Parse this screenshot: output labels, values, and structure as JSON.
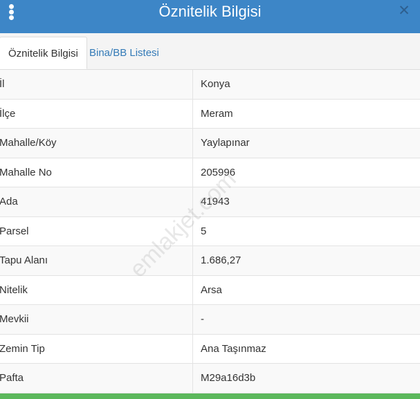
{
  "header": {
    "title": "Öznitelik Bilgisi",
    "close_symbol": "✕",
    "menu_icon": "kebab-vertical-icon",
    "color": "#3d86c7"
  },
  "tabs": [
    {
      "label": "Öznitelik Bilgisi",
      "active": true
    },
    {
      "label": "Bina/BB Listesi",
      "active": false
    }
  ],
  "rows": [
    {
      "label": "İl",
      "value": "Konya"
    },
    {
      "label": "İlçe",
      "value": "Meram"
    },
    {
      "label": "Mahalle/Köy",
      "value": "Yaylapınar"
    },
    {
      "label": "Mahalle No",
      "value": "205996"
    },
    {
      "label": "Ada",
      "value": "41943"
    },
    {
      "label": "Parsel",
      "value": "5"
    },
    {
      "label": "Tapu Alanı",
      "value": "1.686,27"
    },
    {
      "label": "Nitelik",
      "value": "Arsa"
    },
    {
      "label": "Mevkii",
      "value": "-"
    },
    {
      "label": "Zemin Tip",
      "value": "Ana Taşınmaz"
    },
    {
      "label": "Pafta",
      "value": "M29a16d3b"
    }
  ],
  "watermark": "emlakjet.com"
}
